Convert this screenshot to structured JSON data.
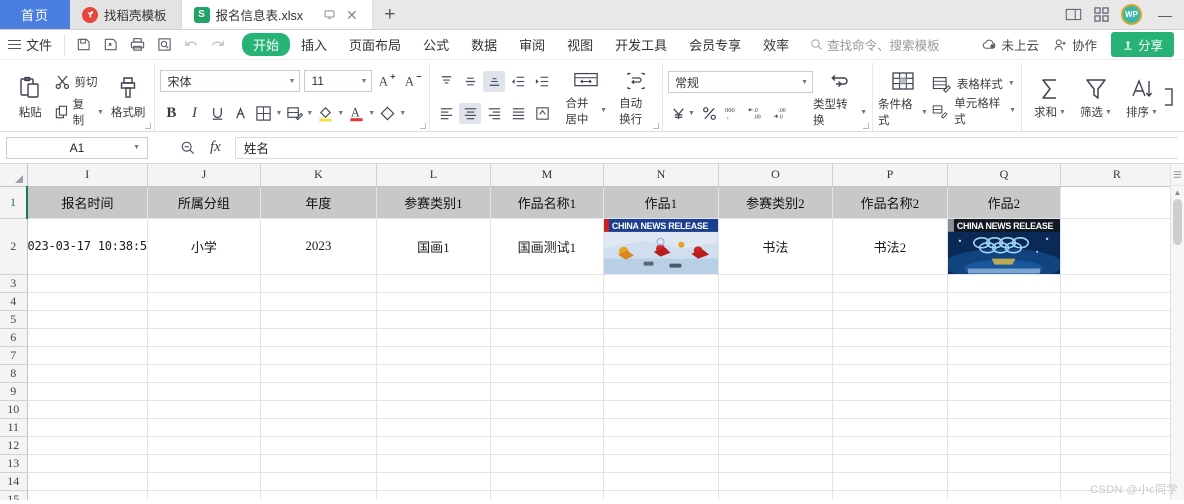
{
  "window": {
    "home_tab": "首页",
    "tabs": [
      {
        "label": "找稻壳模板",
        "icon": "dove-icon",
        "active": false
      },
      {
        "label": "报名信息表.xlsx",
        "icon": "spreadsheet-icon",
        "active": true
      }
    ],
    "new_tab": "+",
    "avatar_text": "WP",
    "minimize": "—"
  },
  "menubar": {
    "file": "文件",
    "quick": [
      "save-icon",
      "save-as-icon",
      "print-icon",
      "print-preview-icon",
      "undo-icon",
      "redo-icon"
    ],
    "tabs": [
      {
        "label": "开始",
        "active": true
      },
      {
        "label": "插入",
        "active": false
      },
      {
        "label": "页面布局",
        "active": false
      },
      {
        "label": "公式",
        "active": false
      },
      {
        "label": "数据",
        "active": false
      },
      {
        "label": "审阅",
        "active": false
      },
      {
        "label": "视图",
        "active": false
      },
      {
        "label": "开发工具",
        "active": false
      },
      {
        "label": "会员专享",
        "active": false
      },
      {
        "label": "效率",
        "active": false
      }
    ],
    "search_placeholder": "查找命令、搜索模板",
    "cloud_status": "未上云",
    "collaborate": "协作",
    "share": "分享"
  },
  "ribbon": {
    "clipboard": {
      "paste": "粘贴",
      "cut": "剪切",
      "copy": "复制",
      "format_painter": "格式刷"
    },
    "font": {
      "family": "宋体",
      "size": "11",
      "grow": "A⁺",
      "shrink": "A⁻",
      "bold": "B",
      "italic": "I",
      "underline": "U"
    },
    "alignment": {
      "merge_center": "合并居中",
      "wrap_text": "自动换行"
    },
    "number": {
      "format": "常规",
      "type_convert": "类型转换"
    },
    "styles": {
      "conditional_format": "条件格式",
      "table_style": "表格样式",
      "cell_style": "单元格样式"
    },
    "editing": {
      "sum": "求和",
      "filter": "筛选",
      "sort": "排序"
    }
  },
  "formula_bar": {
    "name_box": "A1",
    "formula": "姓名"
  },
  "sheet": {
    "columns": [
      "I",
      "J",
      "K",
      "L",
      "M",
      "N",
      "O",
      "P",
      "Q",
      "R"
    ],
    "rows": [
      "1",
      "2",
      "3",
      "4",
      "5",
      "6",
      "7",
      "8",
      "9",
      "10",
      "11",
      "12",
      "13",
      "14",
      "15"
    ],
    "header_row": [
      "报名时间",
      "所属分组",
      "年度",
      "参赛类别1",
      "作品名称1",
      "作品1",
      "参赛类别2",
      "作品名称2",
      "作品2",
      ""
    ],
    "data_row": [
      "023-03-17 10:38:5",
      "小学",
      "2023",
      "国画1",
      "国画测试1",
      "",
      "书法",
      "书法2",
      "",
      ""
    ],
    "images": [
      {
        "column": "N",
        "caption": "CHINA NEWS RELEASE",
        "theme": "winter-sports"
      },
      {
        "column": "Q",
        "caption": "CHINA NEWS RELEASE",
        "theme": "olympic-rings"
      }
    ],
    "watermark": "CSDN @小c同学"
  }
}
